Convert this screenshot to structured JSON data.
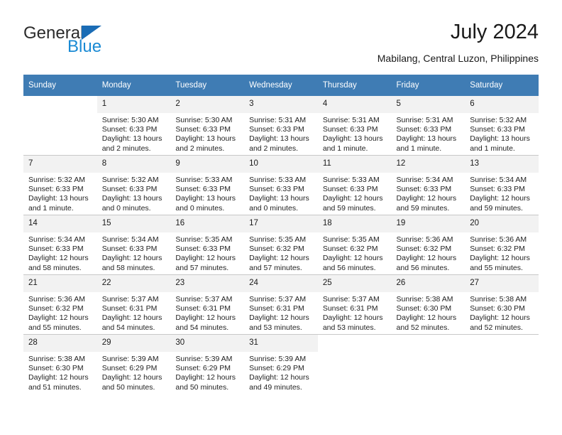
{
  "brand": {
    "name_part1": "General",
    "name_part2": "Blue",
    "triangle_color": "#1a6cb5",
    "blue_color": "#1a8ad4"
  },
  "header": {
    "title": "July 2024",
    "subtitle": "Mabilang, Central Luzon, Philippines",
    "header_bg": "#3f7cb4",
    "daynum_bg": "#f2f2f2"
  },
  "weekday_headers": [
    "Sunday",
    "Monday",
    "Tuesday",
    "Wednesday",
    "Thursday",
    "Friday",
    "Saturday"
  ],
  "weeks": [
    {
      "days": [
        {
          "num": "",
          "blank": true,
          "sunrise": "",
          "sunset": "",
          "daylight": ""
        },
        {
          "num": "1",
          "blank": false,
          "sunrise": "Sunrise: 5:30 AM",
          "sunset": "Sunset: 6:33 PM",
          "daylight": "Daylight: 13 hours and 2 minutes."
        },
        {
          "num": "2",
          "blank": false,
          "sunrise": "Sunrise: 5:30 AM",
          "sunset": "Sunset: 6:33 PM",
          "daylight": "Daylight: 13 hours and 2 minutes."
        },
        {
          "num": "3",
          "blank": false,
          "sunrise": "Sunrise: 5:31 AM",
          "sunset": "Sunset: 6:33 PM",
          "daylight": "Daylight: 13 hours and 2 minutes."
        },
        {
          "num": "4",
          "blank": false,
          "sunrise": "Sunrise: 5:31 AM",
          "sunset": "Sunset: 6:33 PM",
          "daylight": "Daylight: 13 hours and 1 minute."
        },
        {
          "num": "5",
          "blank": false,
          "sunrise": "Sunrise: 5:31 AM",
          "sunset": "Sunset: 6:33 PM",
          "daylight": "Daylight: 13 hours and 1 minute."
        },
        {
          "num": "6",
          "blank": false,
          "sunrise": "Sunrise: 5:32 AM",
          "sunset": "Sunset: 6:33 PM",
          "daylight": "Daylight: 13 hours and 1 minute."
        }
      ]
    },
    {
      "days": [
        {
          "num": "7",
          "blank": false,
          "sunrise": "Sunrise: 5:32 AM",
          "sunset": "Sunset: 6:33 PM",
          "daylight": "Daylight: 13 hours and 1 minute."
        },
        {
          "num": "8",
          "blank": false,
          "sunrise": "Sunrise: 5:32 AM",
          "sunset": "Sunset: 6:33 PM",
          "daylight": "Daylight: 13 hours and 0 minutes."
        },
        {
          "num": "9",
          "blank": false,
          "sunrise": "Sunrise: 5:33 AM",
          "sunset": "Sunset: 6:33 PM",
          "daylight": "Daylight: 13 hours and 0 minutes."
        },
        {
          "num": "10",
          "blank": false,
          "sunrise": "Sunrise: 5:33 AM",
          "sunset": "Sunset: 6:33 PM",
          "daylight": "Daylight: 13 hours and 0 minutes."
        },
        {
          "num": "11",
          "blank": false,
          "sunrise": "Sunrise: 5:33 AM",
          "sunset": "Sunset: 6:33 PM",
          "daylight": "Daylight: 12 hours and 59 minutes."
        },
        {
          "num": "12",
          "blank": false,
          "sunrise": "Sunrise: 5:34 AM",
          "sunset": "Sunset: 6:33 PM",
          "daylight": "Daylight: 12 hours and 59 minutes."
        },
        {
          "num": "13",
          "blank": false,
          "sunrise": "Sunrise: 5:34 AM",
          "sunset": "Sunset: 6:33 PM",
          "daylight": "Daylight: 12 hours and 59 minutes."
        }
      ]
    },
    {
      "days": [
        {
          "num": "14",
          "blank": false,
          "sunrise": "Sunrise: 5:34 AM",
          "sunset": "Sunset: 6:33 PM",
          "daylight": "Daylight: 12 hours and 58 minutes."
        },
        {
          "num": "15",
          "blank": false,
          "sunrise": "Sunrise: 5:34 AM",
          "sunset": "Sunset: 6:33 PM",
          "daylight": "Daylight: 12 hours and 58 minutes."
        },
        {
          "num": "16",
          "blank": false,
          "sunrise": "Sunrise: 5:35 AM",
          "sunset": "Sunset: 6:33 PM",
          "daylight": "Daylight: 12 hours and 57 minutes."
        },
        {
          "num": "17",
          "blank": false,
          "sunrise": "Sunrise: 5:35 AM",
          "sunset": "Sunset: 6:32 PM",
          "daylight": "Daylight: 12 hours and 57 minutes."
        },
        {
          "num": "18",
          "blank": false,
          "sunrise": "Sunrise: 5:35 AM",
          "sunset": "Sunset: 6:32 PM",
          "daylight": "Daylight: 12 hours and 56 minutes."
        },
        {
          "num": "19",
          "blank": false,
          "sunrise": "Sunrise: 5:36 AM",
          "sunset": "Sunset: 6:32 PM",
          "daylight": "Daylight: 12 hours and 56 minutes."
        },
        {
          "num": "20",
          "blank": false,
          "sunrise": "Sunrise: 5:36 AM",
          "sunset": "Sunset: 6:32 PM",
          "daylight": "Daylight: 12 hours and 55 minutes."
        }
      ]
    },
    {
      "days": [
        {
          "num": "21",
          "blank": false,
          "sunrise": "Sunrise: 5:36 AM",
          "sunset": "Sunset: 6:32 PM",
          "daylight": "Daylight: 12 hours and 55 minutes."
        },
        {
          "num": "22",
          "blank": false,
          "sunrise": "Sunrise: 5:37 AM",
          "sunset": "Sunset: 6:31 PM",
          "daylight": "Daylight: 12 hours and 54 minutes."
        },
        {
          "num": "23",
          "blank": false,
          "sunrise": "Sunrise: 5:37 AM",
          "sunset": "Sunset: 6:31 PM",
          "daylight": "Daylight: 12 hours and 54 minutes."
        },
        {
          "num": "24",
          "blank": false,
          "sunrise": "Sunrise: 5:37 AM",
          "sunset": "Sunset: 6:31 PM",
          "daylight": "Daylight: 12 hours and 53 minutes."
        },
        {
          "num": "25",
          "blank": false,
          "sunrise": "Sunrise: 5:37 AM",
          "sunset": "Sunset: 6:31 PM",
          "daylight": "Daylight: 12 hours and 53 minutes."
        },
        {
          "num": "26",
          "blank": false,
          "sunrise": "Sunrise: 5:38 AM",
          "sunset": "Sunset: 6:30 PM",
          "daylight": "Daylight: 12 hours and 52 minutes."
        },
        {
          "num": "27",
          "blank": false,
          "sunrise": "Sunrise: 5:38 AM",
          "sunset": "Sunset: 6:30 PM",
          "daylight": "Daylight: 12 hours and 52 minutes."
        }
      ]
    },
    {
      "days": [
        {
          "num": "28",
          "blank": false,
          "sunrise": "Sunrise: 5:38 AM",
          "sunset": "Sunset: 6:30 PM",
          "daylight": "Daylight: 12 hours and 51 minutes."
        },
        {
          "num": "29",
          "blank": false,
          "sunrise": "Sunrise: 5:39 AM",
          "sunset": "Sunset: 6:29 PM",
          "daylight": "Daylight: 12 hours and 50 minutes."
        },
        {
          "num": "30",
          "blank": false,
          "sunrise": "Sunrise: 5:39 AM",
          "sunset": "Sunset: 6:29 PM",
          "daylight": "Daylight: 12 hours and 50 minutes."
        },
        {
          "num": "31",
          "blank": false,
          "sunrise": "Sunrise: 5:39 AM",
          "sunset": "Sunset: 6:29 PM",
          "daylight": "Daylight: 12 hours and 49 minutes."
        },
        {
          "num": "",
          "blank": true,
          "sunrise": "",
          "sunset": "",
          "daylight": ""
        },
        {
          "num": "",
          "blank": true,
          "sunrise": "",
          "sunset": "",
          "daylight": ""
        },
        {
          "num": "",
          "blank": true,
          "sunrise": "",
          "sunset": "",
          "daylight": ""
        }
      ]
    }
  ]
}
